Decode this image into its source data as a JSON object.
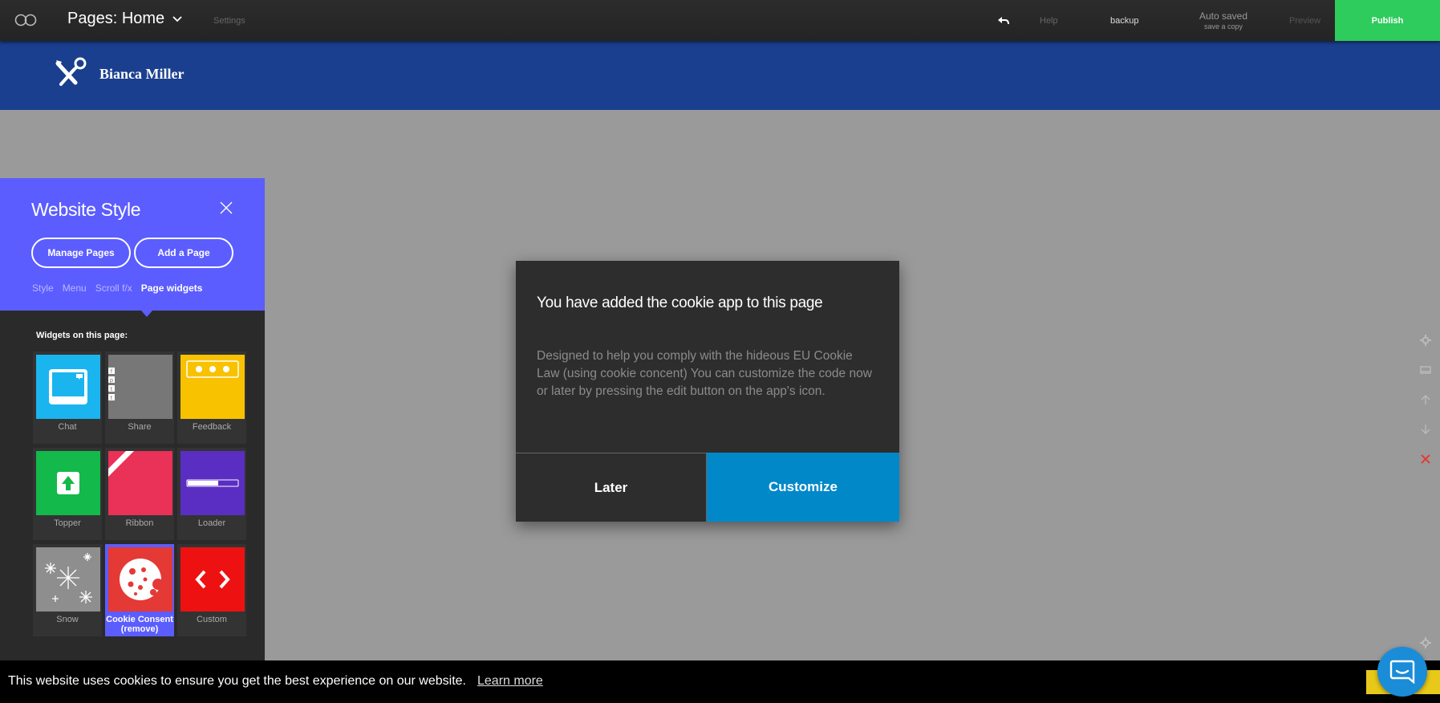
{
  "topbar": {
    "page_select_label": "Pages: Home",
    "settings": "Settings",
    "help": "Help",
    "backup": "backup",
    "autosave_status": "Auto saved",
    "autosave_action": "save a copy",
    "preview": "Preview",
    "publish": "Publish"
  },
  "site": {
    "name": "Bianca Miller"
  },
  "panel": {
    "title": "Website Style",
    "buttons": [
      "Manage Pages",
      "Add a Page"
    ],
    "subtabs": [
      "Style",
      "Menu",
      "Scroll f/x",
      "Page widgets"
    ],
    "active_subtab": "Page widgets",
    "widgets_heading": "Widgets on this page:",
    "widgets": [
      {
        "label": "Chat",
        "color": "#1ab5ef"
      },
      {
        "label": "Share",
        "color": "#777777"
      },
      {
        "label": "Feedback",
        "color": "#f8c200"
      },
      {
        "label": "Topper",
        "color": "#13b94a"
      },
      {
        "label": "Ribbon",
        "color": "#ea3157"
      },
      {
        "label": "Loader",
        "color": "#5a2ec2"
      },
      {
        "label": "Snow",
        "color": "#8e8e8e"
      },
      {
        "label": "Cookie Consent (remove)",
        "color": "#e53935"
      },
      {
        "label": "Custom",
        "color": "#ee1111"
      }
    ],
    "selected_widget": "Cookie Consent (remove)",
    "accent_color": "#5b5dff"
  },
  "dialog": {
    "title": "You have added the cookie app to this page",
    "body": "Designed to help you comply with the hideous EU Cookie Law (using cookie concent) You can customize the code now or later by pressing the edit button on the app's icon.",
    "later": "Later",
    "customize": "Customize",
    "customize_color": "#0088c9"
  },
  "cookiebar": {
    "message": "This website uses cookies to ensure you get the best experience on our website.",
    "learn_more": "Learn more"
  },
  "colors": {
    "header_blue": "#1b3f8f",
    "publish_green": "#2ecc5c"
  }
}
